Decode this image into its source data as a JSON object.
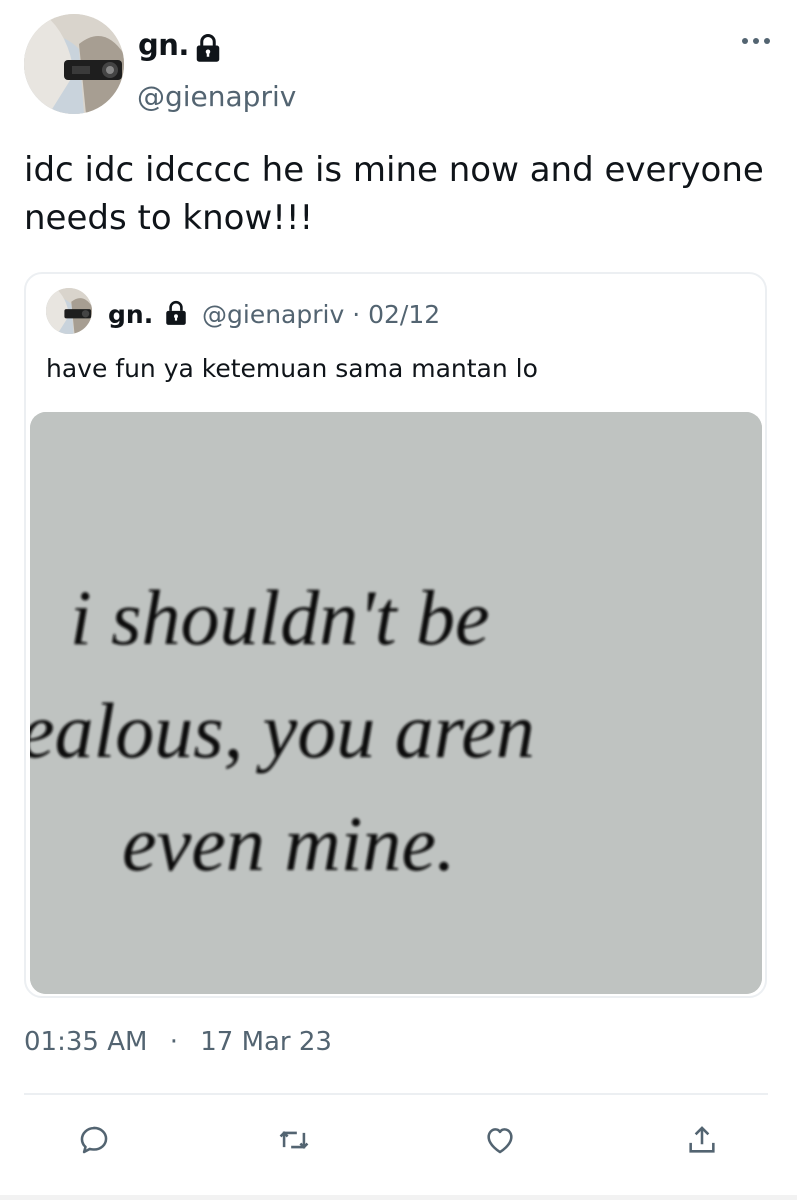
{
  "tweet": {
    "author_name": "gn.",
    "author_handle": "@gienapriv",
    "text": "idc idc idcccc he is mine now and everyone needs to know!!!",
    "time": "01:35 AM",
    "separator": "·",
    "date": "17 Mar 23"
  },
  "quote": {
    "author_name": "gn.",
    "author_handle_date": "@gienapriv · 02/12",
    "text": "have fun ya ketemuan sama mantan lo",
    "image_text_lines": [
      "i shouldn't be",
      "ealous, you aren",
      "even mine."
    ]
  },
  "icons": {
    "lock": "lock-icon",
    "more": "more-icon",
    "reply": "reply-icon",
    "retweet": "retweet-icon",
    "like": "like-icon",
    "share": "share-icon"
  },
  "colors": {
    "text": "#0f1419",
    "secondary": "#536471",
    "border": "#eceff2",
    "image_bg": "#bfc3c1"
  }
}
